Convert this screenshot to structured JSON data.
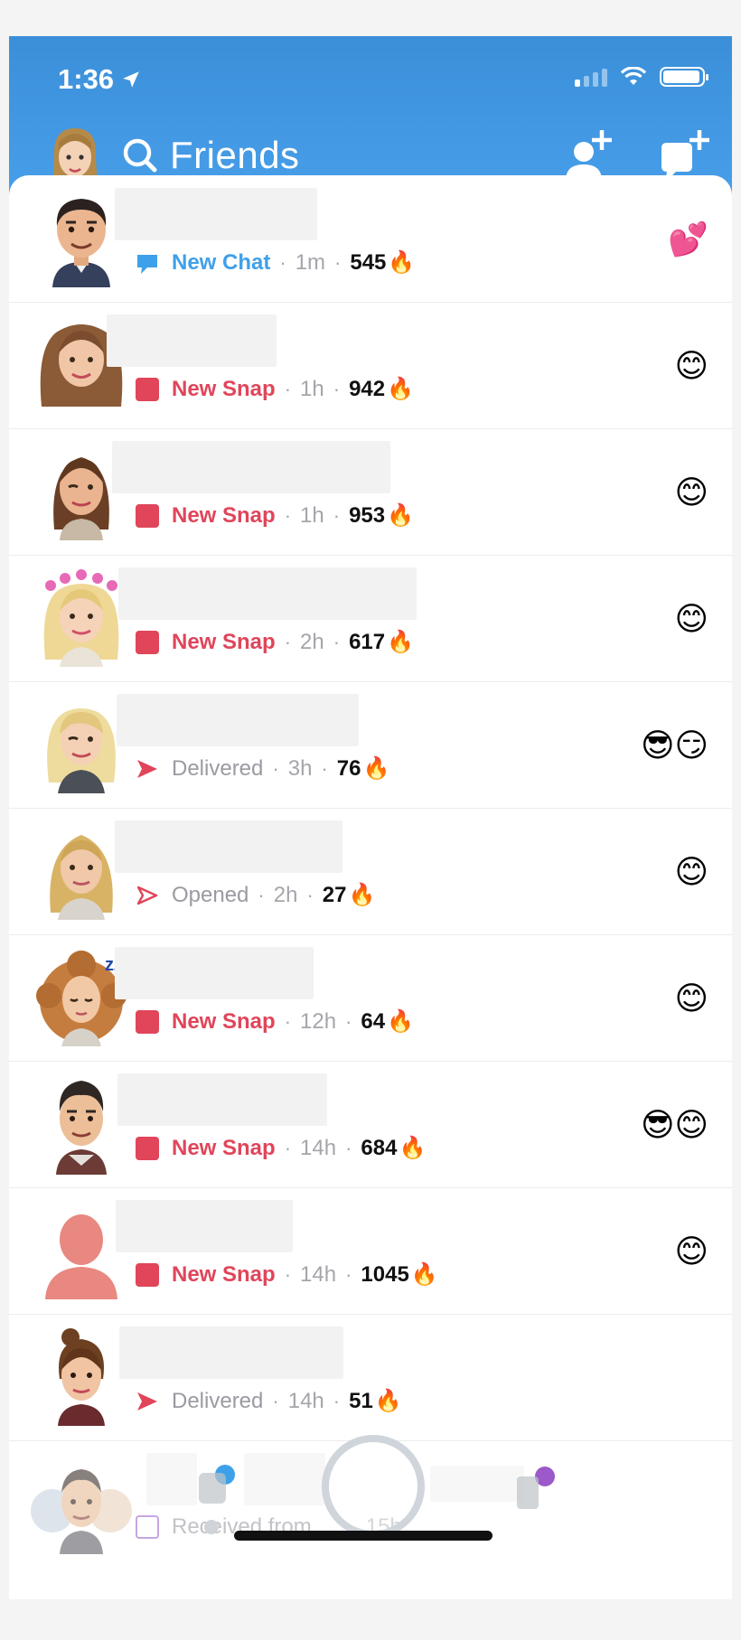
{
  "status_bar": {
    "time": "1:36"
  },
  "header": {
    "title": "Friends"
  },
  "colors": {
    "header_blue": "#4ba3ee",
    "snap_red": "#e0455a",
    "chat_blue": "#3fa0ea",
    "muted_gray": "#a5a5ab"
  },
  "rows": [
    {
      "status": "New Chat",
      "time": "1m",
      "streak": "545",
      "emoji": "💕"
    },
    {
      "status": "New Snap",
      "time": "1h",
      "streak": "942",
      "emoji": "😊"
    },
    {
      "status": "New Snap",
      "time": "1h",
      "streak": "953",
      "emoji": "😊"
    },
    {
      "status": "New Snap",
      "time": "2h",
      "streak": "617",
      "emoji": "😊"
    },
    {
      "status": "Delivered",
      "time": "3h",
      "streak": "76",
      "emoji": "😎😏"
    },
    {
      "status": "Opened",
      "time": "2h",
      "streak": "27",
      "emoji": "😊"
    },
    {
      "status": "New Snap",
      "time": "12h",
      "streak": "64",
      "emoji": "😊"
    },
    {
      "status": "New Snap",
      "time": "14h",
      "streak": "684",
      "emoji": "😎😊"
    },
    {
      "status": "New Snap",
      "time": "14h",
      "streak": "1045",
      "emoji": "😊"
    },
    {
      "status": "Delivered",
      "time": "14h",
      "streak": "51",
      "emoji": ""
    },
    {
      "status": "Received from",
      "time": "15h",
      "streak": "",
      "emoji": ""
    }
  ],
  "icons": {
    "fire": "🔥",
    "search": "search-icon",
    "add_friend": "add-friend-icon",
    "new_chat": "new-chat-icon",
    "location": "location-arrow-icon"
  }
}
